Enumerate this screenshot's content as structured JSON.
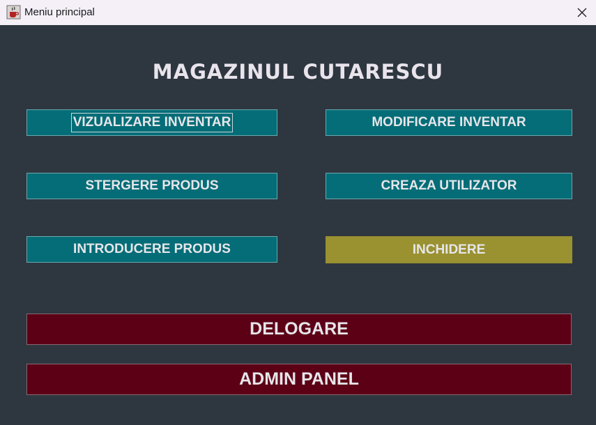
{
  "window": {
    "title": "Meniu principal",
    "icon": "java-cup-icon",
    "close_icon": "close-icon"
  },
  "main": {
    "heading": "MAGAZINUL CUTARESCU",
    "buttons": {
      "view_inventory": "VIZUALIZARE INVENTAR",
      "modify_inventory": "MODIFICARE INVENTAR",
      "delete_product": "STERGERE PRODUS",
      "create_user": "CREAZA UTILIZATOR",
      "add_product": "INTRODUCERE PRODUS",
      "close": "INCHIDERE",
      "logout": "DELOGARE",
      "admin_panel": "ADMIN PANEL"
    }
  },
  "colors": {
    "background": "#2e3740",
    "teal_button": "#056d77",
    "olive_button": "#9a9130",
    "maroon_button": "#5c0016",
    "text": "#e6e6ea"
  }
}
